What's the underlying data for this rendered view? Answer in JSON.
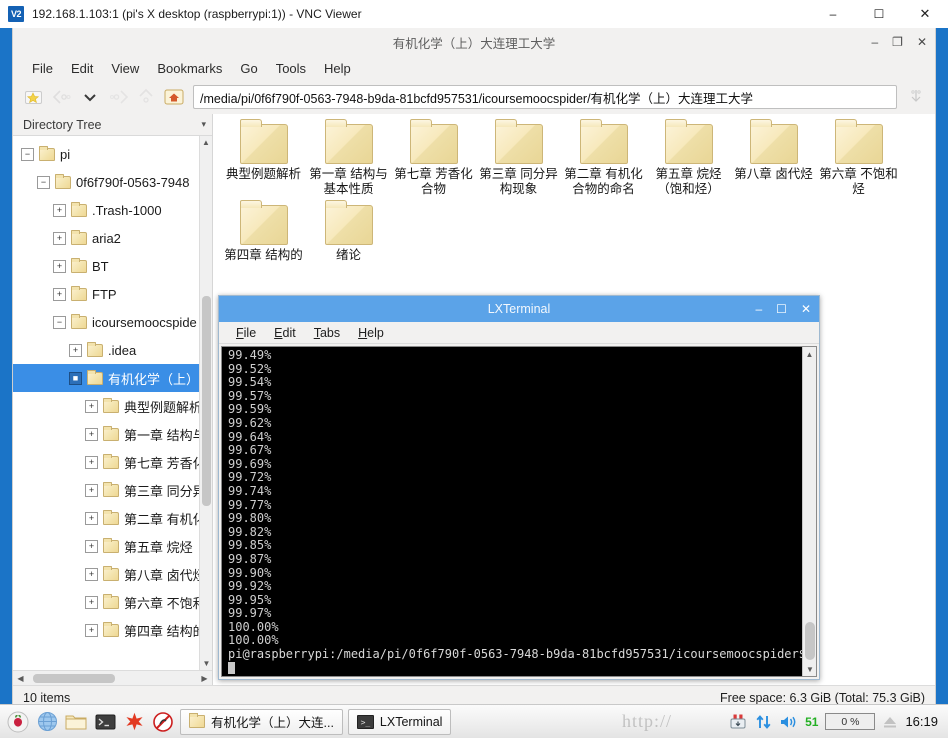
{
  "vnc": {
    "logo_text": "V2",
    "title": "192.168.1.103:1 (pi's X desktop (raspberrypi:1)) - VNC Viewer",
    "minimize": "–",
    "maximize": "☐",
    "close": "✕",
    "accent_color": "#1b74c7"
  },
  "file_manager": {
    "title": "有机化学（上）大连理工大学",
    "window_buttons": {
      "minimize": "–",
      "maximize": "❐",
      "close": "✕"
    },
    "menu": [
      "File",
      "Edit",
      "View",
      "Bookmarks",
      "Go",
      "Tools",
      "Help"
    ],
    "toolbar": {
      "new_tab_icon": "new-tab-icon",
      "back_icon": "back-icon",
      "history_icon": "chevron-down-icon",
      "forward_icon": "forward-icon",
      "up_icon": "go-up-icon",
      "home_icon": "home-icon",
      "end_icon": "view-mode-icon",
      "path_value": "/media/pi/0f6f790f-0563-7948-b9da-81bcfd957531/icoursemoocspider/有机化学（上）大连理工大学",
      "path_placeholder": "Location"
    },
    "sidebar": {
      "header": "Directory Tree",
      "collapse_icon": "chevron-down-icon",
      "items": [
        {
          "label": "pi",
          "depth": 1,
          "expander": "−"
        },
        {
          "label": "0f6f790f-0563-7948",
          "depth": 2,
          "expander": "−"
        },
        {
          "label": ".Trash-1000",
          "depth": 3,
          "expander": "+"
        },
        {
          "label": "aria2",
          "depth": 3,
          "expander": "+"
        },
        {
          "label": "BT",
          "depth": 3,
          "expander": "+"
        },
        {
          "label": "FTP",
          "depth": 3,
          "expander": "+"
        },
        {
          "label": "icoursemoocspide",
          "depth": 3,
          "expander": "−"
        },
        {
          "label": ".idea",
          "depth": 4,
          "expander": "+"
        },
        {
          "label": "有机化学（上）",
          "depth": 4,
          "expander": "■",
          "selected": true
        },
        {
          "label": "典型例题解析",
          "depth": 5,
          "expander": "+"
        },
        {
          "label": "第一章 结构与",
          "depth": 5,
          "expander": "+"
        },
        {
          "label": "第七章 芳香化",
          "depth": 5,
          "expander": "+"
        },
        {
          "label": "第三章 同分异",
          "depth": 5,
          "expander": "+"
        },
        {
          "label": "第二章 有机化",
          "depth": 5,
          "expander": "+"
        },
        {
          "label": "第五章 烷烃 （",
          "depth": 5,
          "expander": "+"
        },
        {
          "label": "第八章 卤代烃",
          "depth": 5,
          "expander": "+"
        },
        {
          "label": "第六章 不饱和",
          "depth": 5,
          "expander": "+"
        },
        {
          "label": "第四章 结构的",
          "depth": 5,
          "expander": "+"
        }
      ]
    },
    "files": [
      {
        "name": "典型例题解析"
      },
      {
        "name": "第一章 结构与基本性质"
      },
      {
        "name": "第七章 芳香化合物"
      },
      {
        "name": "第三章 同分异构现象"
      },
      {
        "name": "第二章 有机化合物的命名"
      },
      {
        "name": "第五章 烷烃（饱和烃）"
      },
      {
        "name": "第八章 卤代烃"
      },
      {
        "name": "第六章 不饱和烃"
      },
      {
        "name": "第四章 结构的"
      },
      {
        "name": "绪论"
      }
    ],
    "statusbar": {
      "item_count": "10 items",
      "free_space": "Free space: 6.3 GiB (Total: 75.3 GiB)"
    }
  },
  "terminal": {
    "title": "LXTerminal",
    "window_buttons": {
      "minimize": "–",
      "maximize": "☐",
      "close": "✕"
    },
    "menu": [
      "File",
      "Edit",
      "Tabs",
      "Help"
    ],
    "output_lines": [
      "99.49%",
      "99.52%",
      "99.54%",
      "99.57%",
      "99.59%",
      "99.62%",
      "99.64%",
      "99.67%",
      "99.69%",
      "99.72%",
      "99.74%",
      "99.77%",
      "99.80%",
      "99.82%",
      "99.85%",
      "99.87%",
      "99.90%",
      "99.92%",
      "99.95%",
      "99.97%",
      "100.00%",
      "100.00%"
    ],
    "prompt": "pi@raspberrypi:/media/pi/0f6f790f-0563-7948-b9da-81bcfd957531/icoursemoocspider$"
  },
  "taskbar": {
    "launchers": [
      {
        "name": "raspberry-menu-icon"
      },
      {
        "name": "web-browser-icon"
      },
      {
        "name": "file-manager-icon"
      },
      {
        "name": "terminal-icon"
      },
      {
        "name": "mathematica-icon"
      },
      {
        "name": "wolfram-icon"
      }
    ],
    "tasks": [
      {
        "label": "有机化学（上）大连...",
        "icon": "folder-icon"
      },
      {
        "label": "LXTerminal",
        "icon": "terminal-icon"
      }
    ],
    "tray": {
      "bluetooth_icon": "bluetooth-icon",
      "network_icon": "network-updown-icon",
      "volume_icon": "volume-icon",
      "volume_value": "51",
      "cpu_value": "0 %",
      "eject_icon": "eject-icon",
      "clock": "16:19"
    },
    "watermark": "http://"
  }
}
